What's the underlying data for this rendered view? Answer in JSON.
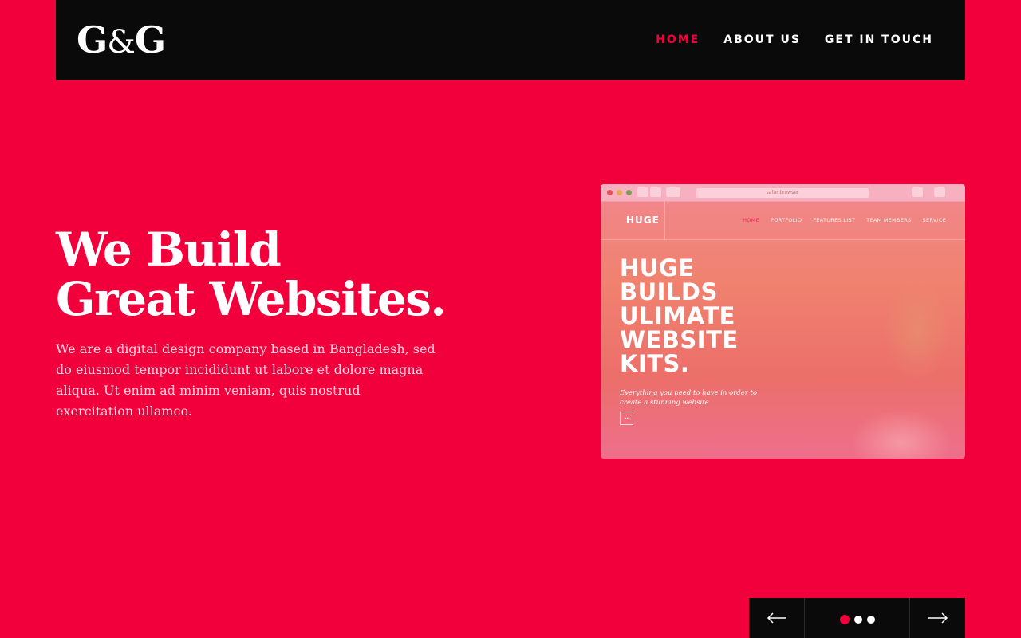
{
  "brand": {
    "logo_left": "G",
    "logo_amp": "&",
    "logo_right": "G"
  },
  "nav": [
    {
      "label": "HOME",
      "active": true
    },
    {
      "label": "ABOUT US",
      "active": false
    },
    {
      "label": "GET IN TOUCH",
      "active": false
    }
  ],
  "hero": {
    "title_line1": "We Build",
    "title_line2": "Great Websites.",
    "description": "We are a digital design company based in Bangladesh, sed do eiusmod tempor incididunt ut labore et dolore magna aliqua. Ut enim ad minim veniam, quis nostrud exercitation ullamco."
  },
  "mockup": {
    "url": "safaribrowser",
    "logo": "HUGE",
    "links": [
      "HOME",
      "PORTFOLIO",
      "FEATURES LIST",
      "TEAM MEMBERS",
      "SERVICE"
    ],
    "headline_lines": [
      "HUGE",
      "BUILDS",
      "ULIMATE",
      "WEBSITE",
      "KITS."
    ],
    "subtitle": "Everything you need to have in order to create a stunning website"
  },
  "slider": {
    "slide_count": 3,
    "active_index": 0
  },
  "colors": {
    "accent": "#f2003c",
    "dark": "#0a0a0a",
    "text": "#ffffff"
  },
  "icons": {
    "prev": "arrow-left-icon",
    "next": "arrow-right-icon",
    "scroll": "chevron-down-icon"
  }
}
